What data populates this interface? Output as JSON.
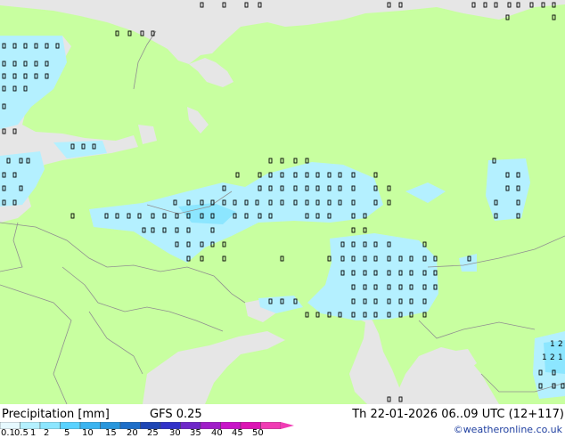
{
  "title": "Precipitation [mm]",
  "model": "GFS 0.25",
  "run": "Th 22-01-2026 06..09 UTC (12+117)",
  "credit": "©weatheronline.co.uk",
  "legend": {
    "labels": [
      "0.1",
      "0.5",
      "1",
      "2",
      "5",
      "10",
      "15",
      "20",
      "25",
      "30",
      "35",
      "40",
      "45",
      "50"
    ],
    "colors": [
      "#e6f9ff",
      "#b4f0ff",
      "#8ce6ff",
      "#5ad2ff",
      "#3cb4f0",
      "#2896dc",
      "#1e6ec8",
      "#1e46b4",
      "#3232c8",
      "#6e28c8",
      "#a01ec8",
      "#c814c8",
      "#dc14b4",
      "#f03cb4"
    ]
  },
  "colors": {
    "land": "#c8ffa0",
    "sea": "#e6e6e6",
    "precip_light": "#b4f0ff",
    "precip_medium": "#8ce6ff",
    "border": "#909090"
  },
  "map_labels": [
    "1",
    "1",
    "2",
    "1",
    "2"
  ]
}
